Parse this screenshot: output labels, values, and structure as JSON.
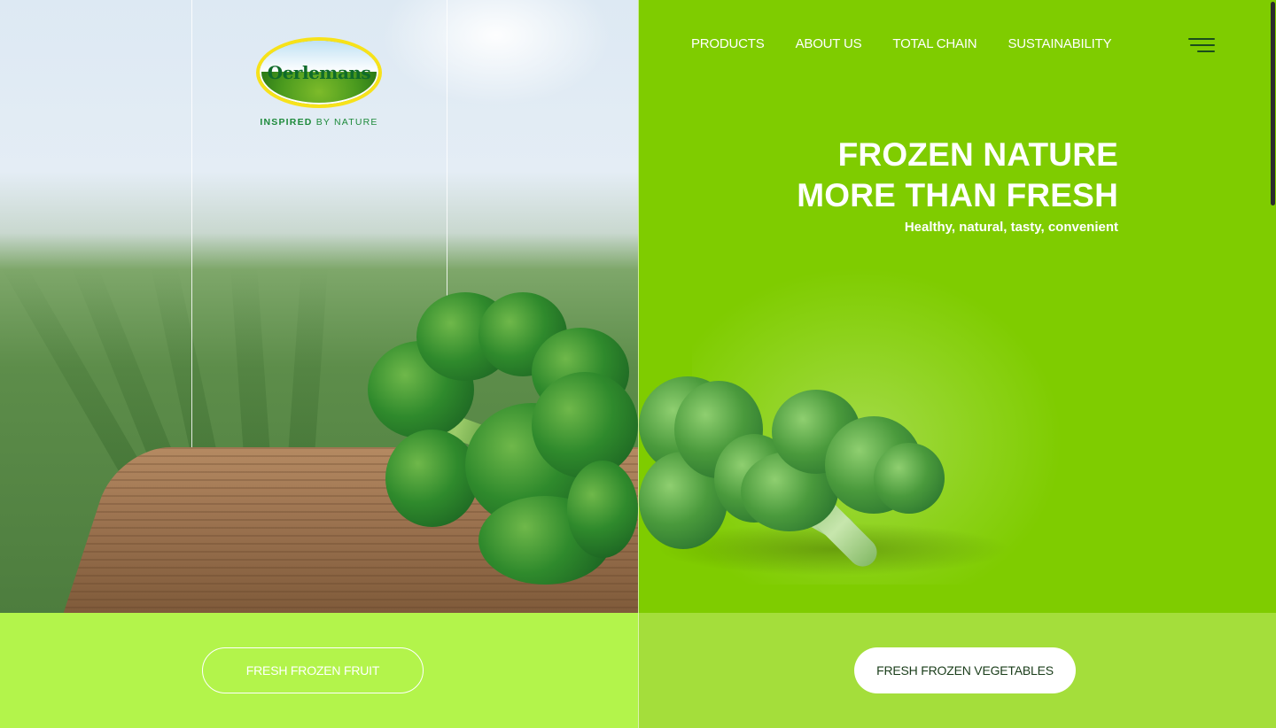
{
  "brand": {
    "name": "Oerlemans",
    "tagline_bold": "INSPIRED",
    "tagline_rest": "BY NATURE"
  },
  "nav": {
    "items": [
      {
        "label": "PRODUCTS"
      },
      {
        "label": "ABOUT US"
      },
      {
        "label": "TOTAL CHAIN"
      },
      {
        "label": "SUSTAINABILITY"
      }
    ],
    "menu_icon": "hamburger-menu-icon"
  },
  "hero": {
    "headline_line1": "FROZEN NATURE",
    "headline_line2": "MORE THAN FRESH",
    "subheadline": "Healthy, natural, tasty, convenient"
  },
  "ctas": {
    "fruit_label": "FRESH FROZEN FRUIT",
    "vegetables_label": "FRESH FROZEN VEGETABLES"
  },
  "colors": {
    "right_panel_green": "#7fcc00",
    "left_band_green": "#b3f44b",
    "right_band_green": "#a4de3b",
    "logo_dark_green": "#0f6b2a",
    "logo_yellow": "#f7e21a"
  }
}
